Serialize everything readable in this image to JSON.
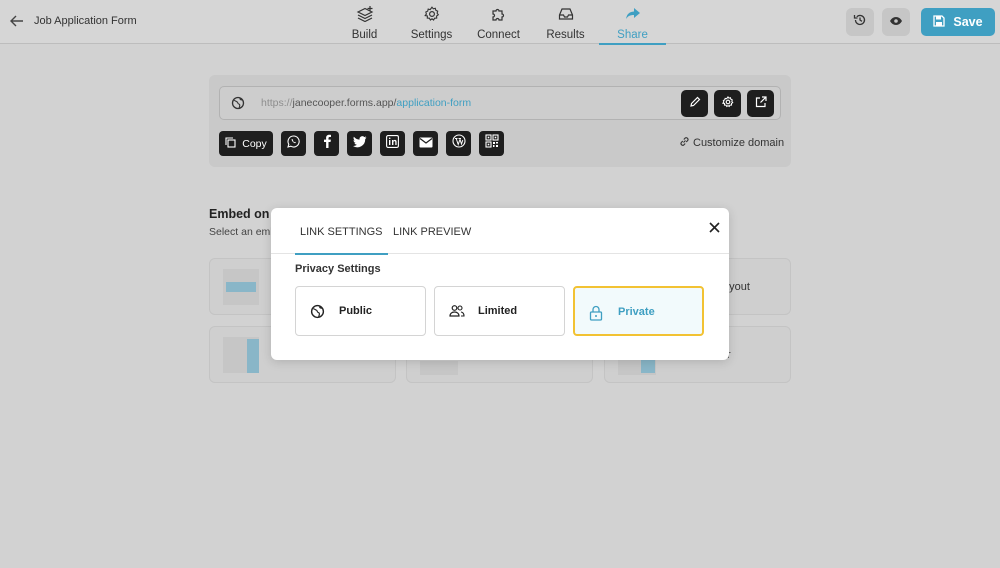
{
  "header": {
    "title": "Job Application Form",
    "nav": [
      {
        "label": "Build",
        "icon": "layers-plus-icon"
      },
      {
        "label": "Settings",
        "icon": "gear-icon"
      },
      {
        "label": "Connect",
        "icon": "puzzle-icon"
      },
      {
        "label": "Results",
        "icon": "inbox-icon"
      },
      {
        "label": "Share",
        "icon": "share-arrow-icon",
        "active": true
      }
    ],
    "save_label": "Save"
  },
  "share": {
    "url_protocol": "https://",
    "url_domain": "janecooper.forms.app/",
    "url_slug": "application-form",
    "copy_label": "Copy",
    "customize_label": "Customize domain",
    "social": [
      "whatsapp-icon",
      "facebook-icon",
      "twitter-icon",
      "linkedin-icon",
      "email-icon",
      "wordpress-icon",
      "qr-code-icon"
    ]
  },
  "embed": {
    "title": "Embed on y",
    "subtitle": "Select an emb",
    "labels": [
      "ayout",
      "r"
    ]
  },
  "modal": {
    "tabs": [
      "LINK SETTINGS",
      "LINK PREVIEW"
    ],
    "privacy_title": "Privacy Settings",
    "options": [
      {
        "label": "Public",
        "icon": "globe-icon"
      },
      {
        "label": "Limited",
        "icon": "users-icon"
      },
      {
        "label": "Private",
        "icon": "lock-icon",
        "selected": true
      }
    ]
  },
  "colors": {
    "accent": "#3f9fc2",
    "selected_border": "#f2c233",
    "overlay": "#d2d2d2",
    "dark_button": "#1e1e1e"
  }
}
